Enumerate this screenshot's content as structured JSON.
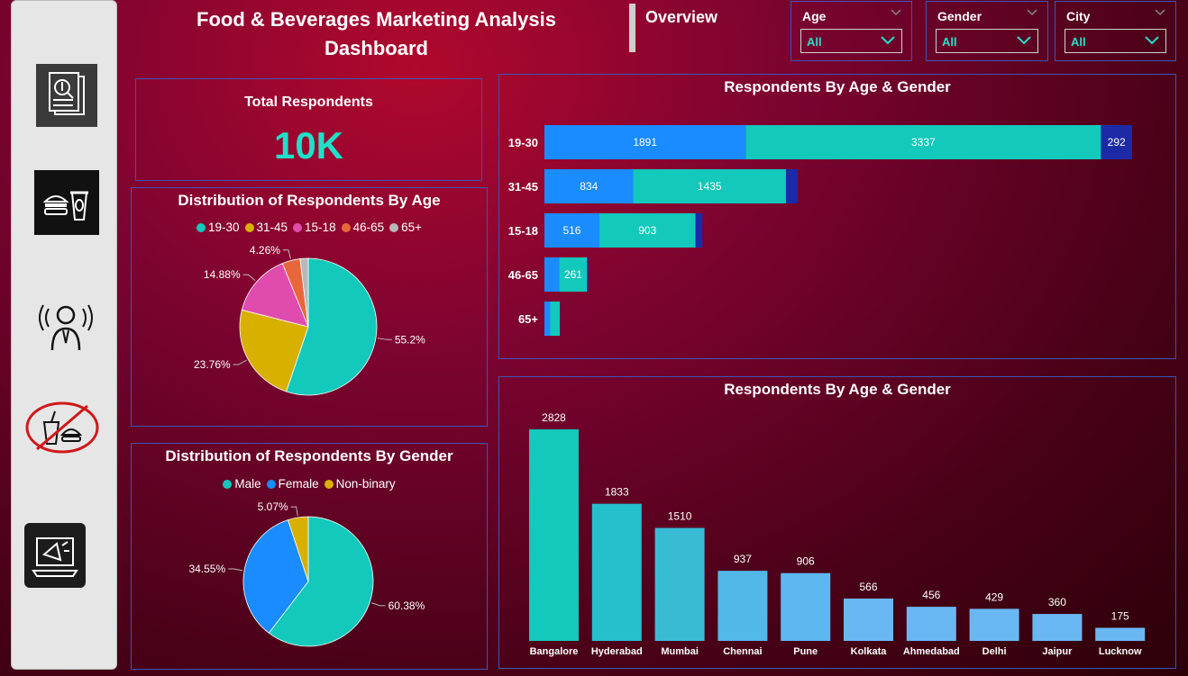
{
  "header": {
    "title": "Food & Beverages Marketing Analysis Dashboard",
    "page_label": "Overview"
  },
  "filters": [
    {
      "label": "Age",
      "value": "All"
    },
    {
      "label": "Gender",
      "value": "All"
    },
    {
      "label": "City",
      "value": "All"
    }
  ],
  "sidebar": {
    "items": [
      {
        "icon": "report-icon"
      },
      {
        "icon": "food-drink-icon"
      },
      {
        "icon": "speaker-person-icon"
      },
      {
        "icon": "no-junk-food-icon"
      },
      {
        "icon": "megaphone-laptop-icon"
      }
    ]
  },
  "kpi": {
    "label": "Total Respondents",
    "value": "10K"
  },
  "colors": {
    "teal": "#12c9bb",
    "blue": "#1a8cff",
    "navy": "#1c2aa6",
    "gold": "#d8b000",
    "pink": "#e04cae",
    "orange": "#e8673a",
    "gray": "#b8b8b8",
    "light_blue": "#6ab8f2"
  },
  "chart_data": [
    {
      "id": "age-pie",
      "type": "pie",
      "title": "Distribution of Respondents By Age",
      "labels": [
        "19-30",
        "31-45",
        "15-18",
        "46-65",
        "65+"
      ],
      "values": [
        55.2,
        23.76,
        14.88,
        4.26,
        1.9
      ],
      "data_labels": [
        "55.2%",
        "23.76%",
        "14.88%",
        "4.26%",
        ""
      ],
      "colors": [
        "#12c9bb",
        "#d8b000",
        "#e04cae",
        "#e8673a",
        "#b8b8b8"
      ],
      "legend": "top"
    },
    {
      "id": "gender-pie",
      "type": "pie",
      "title": "Distribution of Respondents By Gender",
      "labels": [
        "Male",
        "Female",
        "Non-binary"
      ],
      "values": [
        60.38,
        34.55,
        5.07
      ],
      "data_labels": [
        "60.38%",
        "34.55%",
        "5.07%"
      ],
      "colors": [
        "#12c9bb",
        "#1a8cff",
        "#d8b000"
      ],
      "legend": "top"
    },
    {
      "id": "age-gender-bar",
      "type": "bar",
      "orientation": "horizontal",
      "stacked": true,
      "title": "Respondents By Age & Gender",
      "categories": [
        "19-30",
        "31-45",
        "15-18",
        "46-65",
        "65+"
      ],
      "series": [
        {
          "values": [
            1891,
            834,
            516,
            140,
            55
          ],
          "labels": [
            "1891",
            "834",
            "516",
            "",
            ""
          ],
          "color": "#1a8cff"
        },
        {
          "values": [
            3337,
            1435,
            903,
            261,
            90
          ],
          "labels": [
            "3337",
            "1435",
            "903",
            "261",
            ""
          ],
          "color": "#12c9bb"
        },
        {
          "values": [
            292,
            110,
            65,
            10,
            3
          ],
          "labels": [
            "292",
            "",
            "",
            "",
            ""
          ],
          "color": "#1c2aa6"
        }
      ],
      "xlim": [
        0,
        5800
      ],
      "grid": false
    },
    {
      "id": "city-bar",
      "type": "bar",
      "title": "Respondents By Age & Gender",
      "categories": [
        "Bangalore",
        "Hyderabad",
        "Mumbai",
        "Chennai",
        "Pune",
        "Kolkata",
        "Ahmedabad",
        "Delhi",
        "Jaipur",
        "Lucknow"
      ],
      "values": [
        2828,
        1833,
        1510,
        937,
        906,
        566,
        456,
        429,
        360,
        175
      ],
      "colors": [
        "#12c9bb",
        "#25c0cc",
        "#38bcd6",
        "#52b8e8",
        "#5cb8ee",
        "#6ab8f2",
        "#6ab8f2",
        "#6ab8f2",
        "#6ab8f2",
        "#6ab8f2"
      ],
      "ylim": [
        0,
        2900
      ],
      "grid": false
    }
  ]
}
